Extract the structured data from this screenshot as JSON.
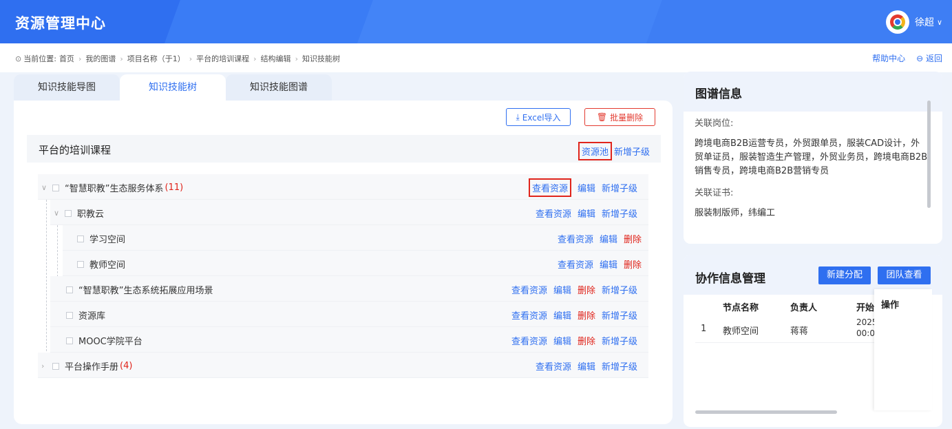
{
  "app_title": "资源管理中心",
  "user": {
    "name": "徐超"
  },
  "breadcrumb": {
    "prefix": "当前位置:",
    "items": [
      "首页",
      "我的图谱",
      "项目名称（于1）",
      "平台的培训课程",
      "结构编辑",
      "知识技能树"
    ],
    "help": "帮助中心",
    "back": "返回"
  },
  "tabs": [
    "知识技能导图",
    "知识技能树",
    "知识技能图谱"
  ],
  "active_tab": "知识技能树",
  "toolbar": {
    "import": "Excel导入",
    "batch_delete": "批量删除"
  },
  "root": {
    "title": "平台的培训课程",
    "pool": "资源池",
    "add_child": "新增子级"
  },
  "actions": {
    "view": "查看资源",
    "edit": "编辑",
    "delete": "删除",
    "add_child": "新增子级"
  },
  "tree": [
    {
      "label": "“智慧职教”生态服务体系",
      "count": "(11)"
    },
    {
      "label": "职教云"
    },
    {
      "label": "学习空间"
    },
    {
      "label": "教师空间"
    },
    {
      "label": "“智慧职教”生态系统拓展应用场景"
    },
    {
      "label": "资源库"
    },
    {
      "label": "MOOC学院平台"
    },
    {
      "label": "平台操作手册",
      "count": "(4)"
    }
  ],
  "info": {
    "title": "图谱信息",
    "post_label": "关联岗位:",
    "posts": "跨境电商B2B运营专员，外贸跟单员，服装CAD设计，外贸单证员，服装智造生产管理，外贸业务员，跨境电商B2B销售专员，跨境电商B2B营销专员",
    "cert_label": "关联证书:",
    "certs": "服装制版师，纬编工"
  },
  "collab": {
    "title": "协作信息管理",
    "new_btn": "新建分配",
    "team_btn": "团队查看",
    "columns": [
      "节点名称",
      "负责人",
      "开始",
      "操作"
    ],
    "rows": [
      {
        "index": "1",
        "node": "教师空间",
        "owner": "蒋蒋",
        "start_1": "2025",
        "start_2": "00:0"
      }
    ]
  }
}
